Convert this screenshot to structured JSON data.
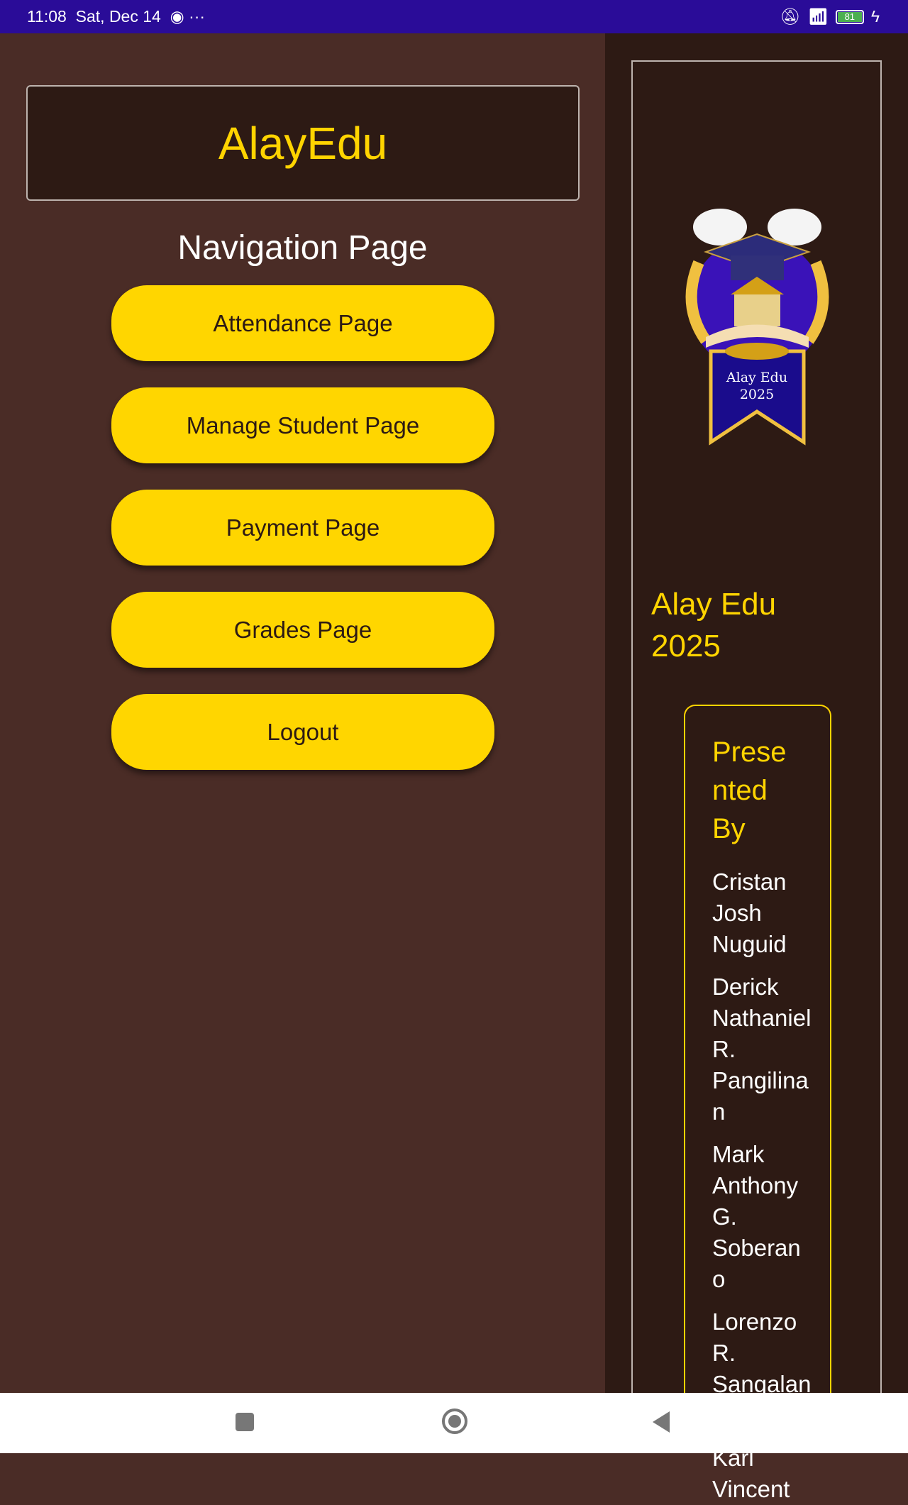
{
  "status_bar": {
    "time": "11:08",
    "date": "Sat, Dec 14",
    "battery": "81"
  },
  "header": {
    "app_title": "AlayEdu"
  },
  "nav": {
    "title": "Navigation Page",
    "buttons": [
      "Attendance Page",
      "Manage Student Page",
      "Payment Page",
      "Grades Page",
      "Logout"
    ]
  },
  "sidebar": {
    "logo_text": "Alay Edu 2025",
    "title": "Alay Edu 2025",
    "presented_by": "Presented By",
    "names": [
      "Cristan Josh Nuguid",
      "Derick Nathaniel R. Pangilinan",
      "Mark Anthony G. Soberano",
      "Lorenzo R. Sangalang",
      "Karl Vincent"
    ]
  },
  "colors": {
    "accent": "#ffd600",
    "bg": "#4a2c26",
    "panel": "#2d1a14",
    "status": "#2a0c98"
  }
}
